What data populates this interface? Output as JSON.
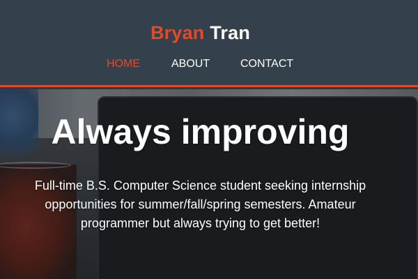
{
  "header": {
    "brand": {
      "first": "Bryan",
      "last": "Tran"
    },
    "nav": [
      {
        "label": "HOME",
        "active": true
      },
      {
        "label": "ABOUT",
        "active": false
      },
      {
        "label": "CONTACT",
        "active": false
      }
    ]
  },
  "hero": {
    "title": "Always improving",
    "lines": [
      "Full-time B.S. Computer Science student seeking internship",
      "opportunities for summer/fall/spring semesters. Amateur",
      "programmer but always trying to get better!"
    ]
  },
  "colors": {
    "accent": "#e24a2a",
    "header_bg": "#34414c",
    "text": "#ffffff"
  }
}
